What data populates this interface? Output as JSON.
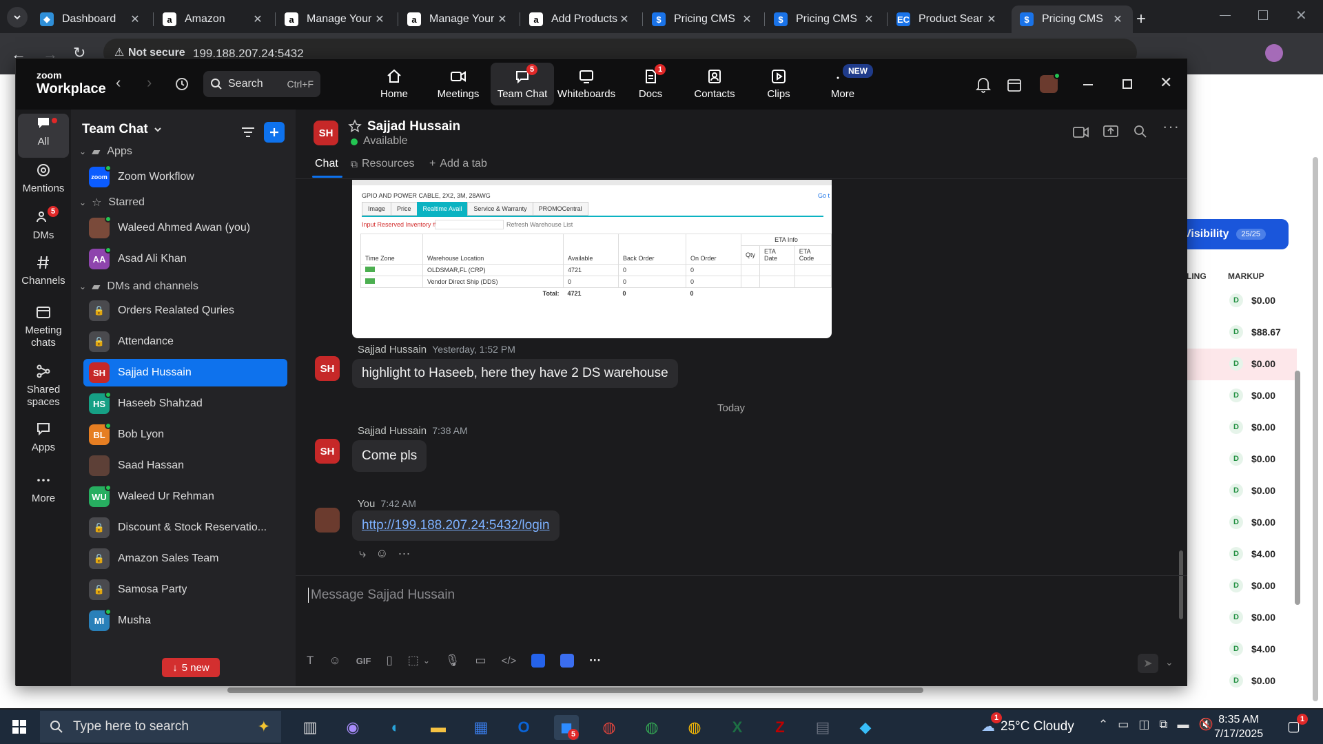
{
  "browser": {
    "tabs": [
      {
        "title": "Dashboard",
        "icon": "diamond-icon",
        "color": "#2f8fd8"
      },
      {
        "title": "Amazon",
        "icon": "amazon-icon",
        "color": "#ffffff"
      },
      {
        "title": "Manage Your",
        "icon": "amazon-icon",
        "color": "#ffffff"
      },
      {
        "title": "Manage Your",
        "icon": "amazon-icon",
        "color": "#ffffff"
      },
      {
        "title": "Add Products",
        "icon": "amazon-icon",
        "color": "#ffffff"
      },
      {
        "title": "Pricing CMS",
        "icon": "dollar-icon",
        "color": "#1a73e8"
      },
      {
        "title": "Pricing CMS",
        "icon": "dollar-icon",
        "color": "#1a73e8"
      },
      {
        "title": "Product Sear",
        "icon": "ec-icon",
        "color": "#1a73e8"
      },
      {
        "title": "Pricing CMS",
        "icon": "dollar-icon",
        "color": "#1a73e8"
      }
    ],
    "security_label": "Not secure",
    "url": "199.188.207.24:5432"
  },
  "zoom": {
    "brand_line1": "zoom",
    "brand_line2": "Workplace",
    "search_label": "Search",
    "search_shortcut": "Ctrl+F",
    "nav": [
      {
        "label": "Home",
        "icon": "home-icon",
        "badge": ""
      },
      {
        "label": "Meetings",
        "icon": "video-icon",
        "badge": ""
      },
      {
        "label": "Team Chat",
        "icon": "chat-icon",
        "badge": "5"
      },
      {
        "label": "Whiteboards",
        "icon": "whiteboard-icon",
        "badge": ""
      },
      {
        "label": "Docs",
        "icon": "docs-icon",
        "badge": "1"
      },
      {
        "label": "Contacts",
        "icon": "contacts-icon",
        "badge": ""
      },
      {
        "label": "Clips",
        "icon": "clips-icon",
        "badge": ""
      },
      {
        "label": "More",
        "icon": "more-icon",
        "badge": "NEW"
      }
    ],
    "rail": [
      {
        "label": "All",
        "icon": "chat-bubble-icon",
        "badge": ""
      },
      {
        "label": "Mentions",
        "icon": "at-icon",
        "badge": ""
      },
      {
        "label": "DMs",
        "icon": "people-icon",
        "badge": "5"
      },
      {
        "label": "Channels",
        "icon": "hash-icon",
        "badge": ""
      },
      {
        "label": "Meeting chats",
        "icon": "calendar-icon",
        "badge": ""
      },
      {
        "label": "Shared spaces",
        "icon": "share-icon",
        "badge": ""
      },
      {
        "label": "Apps",
        "icon": "apps-icon",
        "badge": ""
      },
      {
        "label": "More",
        "icon": "ellipsis-icon",
        "badge": ""
      }
    ],
    "sidebar": {
      "title": "Team Chat",
      "sections": [
        {
          "label": "Apps"
        },
        {
          "label": "Starred"
        },
        {
          "label": "DMs and channels"
        }
      ],
      "apps": [
        {
          "name": "Zoom Workflow",
          "initials": "zoom",
          "color": "#0b5cff"
        }
      ],
      "starred": [
        {
          "name": "Waleed Ahmed Awan (you)",
          "initials": "",
          "color": "#7a4a3a"
        },
        {
          "name": "Asad Ali Khan",
          "initials": "AA",
          "color": "#8e44ad"
        }
      ],
      "channels": [
        {
          "name": "Orders Realated Quries",
          "initials": "",
          "color": "#4a4a4e",
          "locked": true
        },
        {
          "name": "Attendance",
          "initials": "",
          "color": "#4a4a4e",
          "locked": true
        },
        {
          "name": "Sajjad Hussain",
          "initials": "SH",
          "color": "#c62828",
          "locked": false
        },
        {
          "name": "Haseeb Shahzad",
          "initials": "HS",
          "color": "#16a085",
          "locked": false
        },
        {
          "name": "Bob Lyon",
          "initials": "BL",
          "color": "#e67e22",
          "locked": false
        },
        {
          "name": "Saad Hassan",
          "initials": "",
          "color": "#5d4037",
          "locked": false
        },
        {
          "name": "Waleed Ur Rehman",
          "initials": "WU",
          "color": "#27ae60",
          "locked": false
        },
        {
          "name": "Discount & Stock Reservatio...",
          "initials": "",
          "color": "#4a4a4e",
          "locked": true
        },
        {
          "name": "Amazon Sales Team",
          "initials": "",
          "color": "#4a4a4e",
          "locked": true
        },
        {
          "name": "Samosa Party",
          "initials": "",
          "color": "#4a4a4e",
          "locked": true
        },
        {
          "name": "Musha",
          "initials": "MI",
          "color": "#2980b9",
          "locked": false
        }
      ],
      "new_pill": "5 new"
    },
    "chat": {
      "contact_name": "Sajjad Hussain",
      "contact_initials": "SH",
      "status": "Available",
      "tabs": [
        "Chat",
        "Resources",
        "Add a tab"
      ],
      "shared_image": {
        "product": "GPIO AND POWER CABLE, 2X2, 3M, 28AWG",
        "goto": "Go t",
        "tabs": [
          "Image",
          "Price",
          "Realtime Avail",
          "Service & Warranty",
          "PROMOCentral"
        ],
        "reserved_label": "Input Reserved Inventory #",
        "refresh_label": "Refresh Warehouse List",
        "eta_header": "ETA Info",
        "columns": [
          "Time Zone",
          "Warehouse Location",
          "Available",
          "Back Order",
          "On Order",
          "Qty",
          "ETA Date",
          "ETA Code"
        ],
        "rows": [
          {
            "location": "OLDSMAR,FL (CRP)",
            "available": "4721",
            "back": "0",
            "on": "0"
          },
          {
            "location": "Vendor Direct Ship (DDS)",
            "available": "0",
            "back": "0",
            "on": "0"
          }
        ],
        "total_label": "Total:",
        "total_available": "4721",
        "total_back": "0",
        "total_on": "0"
      },
      "messages": [
        {
          "sender": "Sajjad Hussain",
          "time": "Yesterday, 1:52 PM",
          "text": "highlight to Haseeb, here they have 2 DS warehouse"
        },
        {
          "divider": "Today"
        },
        {
          "sender": "Sajjad Hussain",
          "time": "7:38 AM",
          "text": "Come pls"
        },
        {
          "sender": "You",
          "time": "7:42 AM",
          "text": "http://199.188.207.24:5432/login"
        }
      ],
      "compose_placeholder": "Message Sajjad Hussain"
    }
  },
  "background_page": {
    "visibility_label": "Visibility",
    "visibility_count": "25/25",
    "col1": "LING",
    "col2": "MARKUP",
    "markups": [
      "$0.00",
      "$88.67",
      "$0.00",
      "$0.00",
      "$0.00",
      "$0.00",
      "$0.00",
      "$0.00",
      "$4.00",
      "$0.00",
      "$0.00",
      "$4.00",
      "$0.00"
    ],
    "chip": "D"
  },
  "taskbar": {
    "search_placeholder": "Type here to search",
    "weather": "25°C  Cloudy",
    "time": "8:35 AM",
    "date": "7/17/2025",
    "notif_badge": "1",
    "zoom_badge": "5"
  },
  "colors": {
    "accent": "#0e72ed",
    "badge": "#e02828",
    "online": "#23c552",
    "link": "#7db1ff"
  }
}
